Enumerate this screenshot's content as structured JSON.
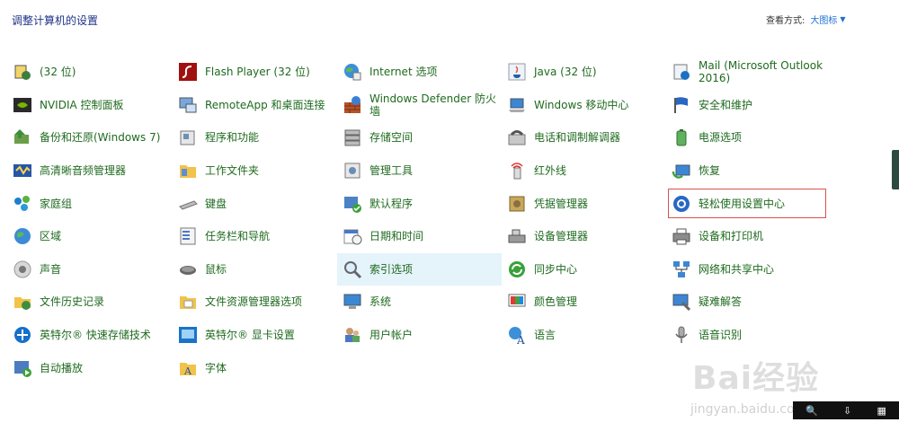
{
  "header": {
    "title": "调整计算机的设置"
  },
  "view_by": {
    "label": "查看方式:",
    "value": "大图标"
  },
  "columns": [
    [
      "(32 位)",
      "NVIDIA 控制面板",
      "备份和还原(Windows 7)",
      "高清晰音频管理器",
      "家庭组",
      "区域",
      "声音",
      "文件历史记录",
      "英特尔® 快速存储技术",
      "自动播放"
    ],
    [
      "Flash Player (32 位)",
      "RemoteApp 和桌面连接",
      "程序和功能",
      "工作文件夹",
      "键盘",
      "任务栏和导航",
      "鼠标",
      "文件资源管理器选项",
      "英特尔® 显卡设置",
      "字体"
    ],
    [
      "Internet 选项",
      "Windows Defender 防火墙",
      "存储空间",
      "管理工具",
      "默认程序",
      "日期和时间",
      "索引选项",
      "系统",
      "用户帐户"
    ],
    [
      "Java (32 位)",
      "Windows 移动中心",
      "电话和调制解调器",
      "红外线",
      "凭据管理器",
      "设备管理器",
      "同步中心",
      "颜色管理",
      "语言"
    ],
    [
      "Mail (Microsoft Outlook 2016)",
      "安全和维护",
      "电源选项",
      "恢复",
      "轻松使用设置中心",
      "设备和打印机",
      "网络和共享中心",
      "疑难解答",
      "语音识别"
    ]
  ],
  "highlighted_item": "索引选项",
  "selected_item": "轻松使用设置中心",
  "watermark": {
    "brand": "Bai经验",
    "url": "jingyan.baidu.com"
  },
  "colors": {
    "link": "#1f6a1f",
    "title": "#1e3287",
    "hover": "#e5f3fb",
    "selection_outline": "#d9534f"
  }
}
